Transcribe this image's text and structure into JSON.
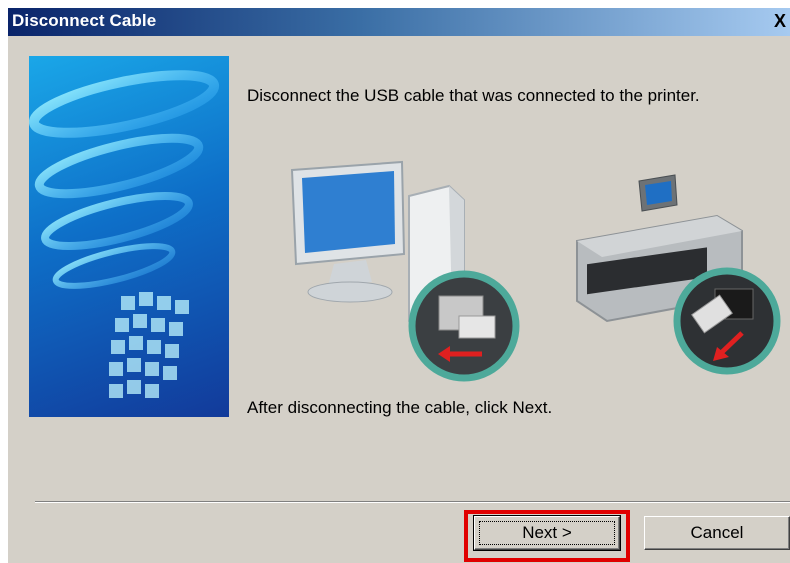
{
  "window": {
    "title": "Disconnect Cable",
    "close_glyph": "X"
  },
  "content": {
    "instruction": "Disconnect the USB cable that was connected to the printer.",
    "after_text": "After disconnecting the cable, click Next."
  },
  "buttons": {
    "next_label": "Next >",
    "cancel_label": "Cancel"
  },
  "colors": {
    "highlight": "#e00000",
    "dialog_bg": "#d4d0c8",
    "titlebar_start": "#0a246a"
  }
}
